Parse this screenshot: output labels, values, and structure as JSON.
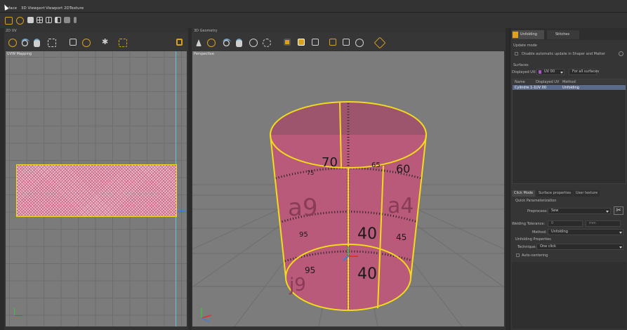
{
  "menu": {
    "items": [
      "rface",
      "3D Viewport",
      "Viewport 2D",
      "Texture"
    ]
  },
  "uv_panel": {
    "title": "2D UV",
    "view_label": "UVW Mapping"
  },
  "geo_panel": {
    "title": "3D Geometry",
    "view_label": "Perspective"
  },
  "texture_digits": {
    "top_a": "70",
    "top_b": "75",
    "top_c": "65",
    "top_d": "60",
    "mid_a": "40",
    "mid_b": "45",
    "mid_c": "95",
    "bot_a": "40",
    "bot_b": "95",
    "big_a": "a9",
    "big_b": "a4",
    "big_c": "j9"
  },
  "right_panel": {
    "tabs": [
      "Unfolding",
      "Stitches"
    ],
    "update_mode_title": "Update mode",
    "disable_update_label": "Disable automatic update in Shaper and Matter",
    "surfaces_title": "Surfaces",
    "displayed_uv_label": "Displayed UV:",
    "displayed_uv_value": "UV 00",
    "for_all_surfaces_label": "For all surfaces",
    "table_headers": [
      "Name",
      "Displayed UV",
      "Method"
    ],
    "table_rows": [
      [
        "Cylindre 1-1",
        "UV 00",
        "Unfolding"
      ]
    ],
    "lower_tabs": [
      "Click Mode",
      "Surface properties",
      "User texture"
    ],
    "quick_param_title": "Quick Parameterization",
    "preprocess_label": "Preprocess:",
    "preprocess_value": "Sew",
    "welding_label": "Welding Tolerance:",
    "welding_value": "0",
    "welding_unit": "mm",
    "method_label": "Method:",
    "method_value": "Unfolding",
    "unfolding_props_title": "Unfolding Properties",
    "technique_label": "Technique:",
    "technique_value": "One click",
    "auto_centering_label": "Auto-centering"
  },
  "colors": {
    "accent": "#e0a020",
    "outline": "#f2dc1a",
    "cylinder": "#c0577a",
    "selection": "#5a6a8a"
  }
}
